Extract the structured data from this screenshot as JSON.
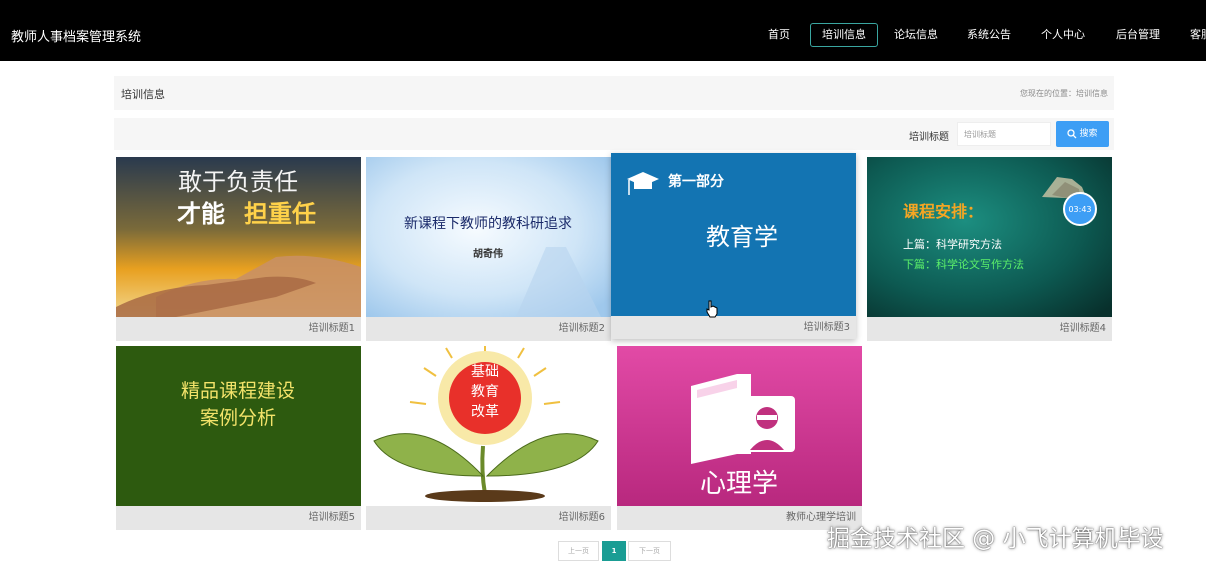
{
  "header": {
    "title": "教师人事档案管理系统",
    "nav": [
      "首页",
      "培训信息",
      "论坛信息",
      "系统公告",
      "个人中心",
      "后台管理",
      "客服"
    ],
    "active": "培训信息"
  },
  "breadcrumb": {
    "title": "培训信息",
    "location": "您现在的位置：培训信息"
  },
  "search": {
    "label": "培训标题",
    "placeholder": "培训标题",
    "button": "搜索"
  },
  "cards": [
    {
      "caption": "培训标题1",
      "thumb_text": [
        "敢于负责任",
        "才能",
        "担重任"
      ]
    },
    {
      "caption": "培训标题2",
      "thumb_text": [
        "新课程下教师的教科研追求",
        "胡奇伟"
      ]
    },
    {
      "caption": "培训标题3",
      "thumb_text": [
        "第一部分",
        "教育学"
      ]
    },
    {
      "caption": "培训标题4",
      "thumb_text": [
        "课程安排：",
        "上篇：科学研究方法",
        "下篇：科学论文写作方法",
        "03:43"
      ]
    },
    {
      "caption": "培训标题5",
      "thumb_text": [
        "精品课程建设",
        "案例分析"
      ]
    },
    {
      "caption": "培训标题6",
      "thumb_text": [
        "基础",
        "教育",
        "改革"
      ]
    },
    {
      "caption": "教师心理学培训",
      "thumb_text": [
        "心理学"
      ]
    }
  ],
  "pagination": {
    "prev": "上一页",
    "current": "1",
    "next": "下一页"
  },
  "watermark": "掘金技术社区 @ 小飞计算机毕设",
  "colors": {
    "topbar": "#000000",
    "accent": "#1a9d94",
    "search_button": "#3d9ef5"
  }
}
